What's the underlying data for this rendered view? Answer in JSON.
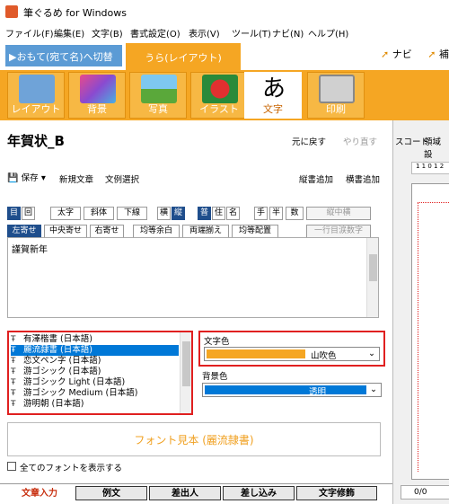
{
  "window": {
    "title": "筆ぐるめ for Windows"
  },
  "menu": [
    "ファイル(F)",
    "編集(E)",
    "文字(B)",
    "書式設定(O)",
    "表示(V)",
    "ツール(T)",
    "ナビ(N)",
    "ヘルプ(H)"
  ],
  "tabs": {
    "front": "▶おもて(宛て名)へ切替",
    "back": "うら(レイアウト)"
  },
  "navi": {
    "label": "ナビ",
    "extra": "補"
  },
  "ribbon": [
    "レイアウト",
    "背景",
    "写真",
    "イラスト",
    "文字",
    "印刷"
  ],
  "doc": {
    "title": "年賀状_B",
    "undo": "元に戻す",
    "redo": "やり直す"
  },
  "toolbar2": {
    "save": "保存",
    "new": "新規文章",
    "sample": "文例選択",
    "add_v": "縦書追加",
    "add_h": "横書追加"
  },
  "formatRow1": [
    "目",
    "回",
    "太字",
    "斜体",
    "下線",
    "横",
    "縦",
    "普",
    "住",
    "名",
    "手",
    "半",
    "数",
    "縦中横"
  ],
  "formatRow2": [
    "左寄せ",
    "中央寄せ",
    "右寄せ",
    "均等余白",
    "両端揃え",
    "均等配置",
    "一行目涙数字"
  ],
  "text": {
    "content": "謹賀新年"
  },
  "fonts": [
    "有澤楷書 (日本語)",
    "麗流隷書 (日本語)",
    "恋文ペン字 (日本語)",
    "游ゴシック (日本語)",
    "游ゴシック Light (日本語)",
    "游ゴシック Medium (日本語)",
    "游明朝 (日本語)"
  ],
  "selectedFontIndex": 1,
  "fontColor": {
    "label": "文字色",
    "value": "山吹色",
    "swatch": "#f5a623"
  },
  "bgColor": {
    "label": "背景色",
    "value": "透明"
  },
  "preview": {
    "text": "フォント見本 (麗流隷書)"
  },
  "showAllFonts": "全てのフォントを表示する",
  "bottomTabs": [
    "文章入力",
    "例文",
    "差出人",
    "差し込み",
    "文字修飾"
  ],
  "right": {
    "code": "スコード",
    "area": "領域設",
    "ruler": "1 1 0 1 2",
    "page": "0/0"
  },
  "colors": {
    "accent": "#f5a623",
    "selection": "#0078d7",
    "highlight": "#e02020"
  }
}
